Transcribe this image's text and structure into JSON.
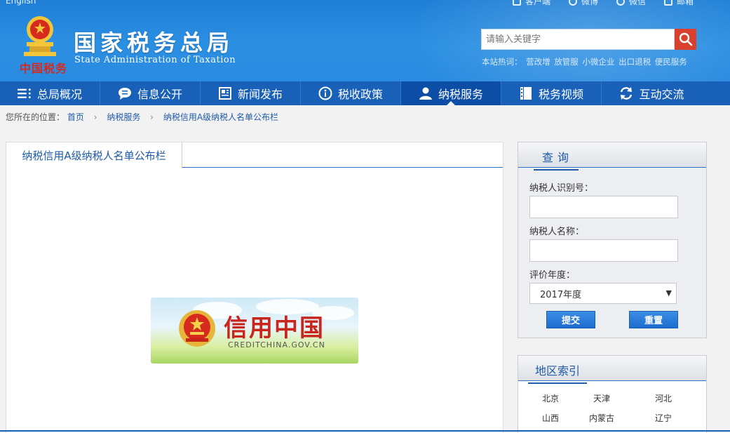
{
  "header": {
    "english_link": "English",
    "top_links": [
      "客户端",
      "微博",
      "微信",
      "邮箱"
    ],
    "title": "国家税务总局",
    "subtitle": "State Administration of Taxation",
    "logo_text": "中国税务",
    "search": {
      "placeholder": "请输入关键字",
      "icon": "search-icon"
    },
    "hot_label": "本站热词：",
    "hot_words": [
      "营改增",
      "放管服",
      "小微企业",
      "出口退税",
      "便民服务"
    ]
  },
  "nav": {
    "items": [
      {
        "label": "总局概况",
        "icon": "menu-list-icon"
      },
      {
        "label": "信息公开",
        "icon": "chat-bubble-icon"
      },
      {
        "label": "新闻发布",
        "icon": "newspaper-icon"
      },
      {
        "label": "税收政策",
        "icon": "info-icon"
      },
      {
        "label": "纳税服务",
        "icon": "user-icon"
      },
      {
        "label": "税务视频",
        "icon": "film-icon"
      },
      {
        "label": "互动交流",
        "icon": "refresh-icon"
      }
    ],
    "active_index": 4
  },
  "breadcrumb": {
    "prefix": "您所在的位置：",
    "items": [
      "首页",
      "纳税服务",
      "纳税信用A级纳税人名单公布栏"
    ]
  },
  "main": {
    "tab_label": "纳税信用A级纳税人名单公布栏",
    "banner": {
      "title": "信用中国",
      "url": "CREDITCHINA.GOV.CN"
    }
  },
  "query": {
    "title": "查询",
    "taxpayer_id_label": "纳税人识别号：",
    "taxpayer_id_value": "",
    "taxpayer_name_label": "纳税人名称：",
    "taxpayer_name_value": "",
    "year_label": "评价年度：",
    "year_selected": "2017年度",
    "submit_label": "提交",
    "reset_label": "重置"
  },
  "region": {
    "title": "地区索引",
    "items": [
      "北京",
      "天津",
      "河北",
      "山西",
      "内蒙古",
      "辽宁"
    ]
  },
  "colors": {
    "header_blue": "#2a8be0",
    "nav_blue": "#1860b8",
    "nav_active": "#0c4ea6",
    "link_blue": "#1e5ba8",
    "search_red": "#d9402e"
  }
}
